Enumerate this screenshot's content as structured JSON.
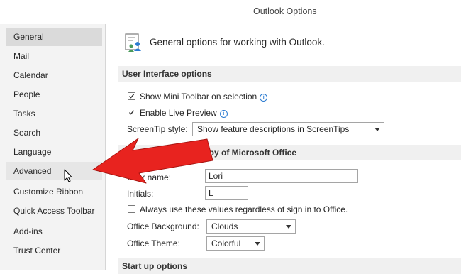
{
  "window": {
    "title": "Outlook Options"
  },
  "sidebar": {
    "items": [
      {
        "label": "General"
      },
      {
        "label": "Mail"
      },
      {
        "label": "Calendar"
      },
      {
        "label": "People"
      },
      {
        "label": "Tasks"
      },
      {
        "label": "Search"
      },
      {
        "label": "Language"
      },
      {
        "label": "Advanced"
      },
      {
        "label": "Customize Ribbon"
      },
      {
        "label": "Quick Access Toolbar"
      },
      {
        "label": "Add-ins"
      },
      {
        "label": "Trust Center"
      }
    ],
    "selected": "General",
    "hovered": "Advanced"
  },
  "main": {
    "header": "General options for working with Outlook.",
    "ui_options": {
      "title": "User Interface options",
      "mini_toolbar": {
        "label": "Show Mini Toolbar on selection",
        "checked": true
      },
      "live_preview": {
        "label": "Enable Live Preview",
        "checked": true
      },
      "screentip": {
        "label": "ScreenTip style:",
        "value": "Show feature descriptions in ScreenTips"
      }
    },
    "personalize": {
      "title": "Personalize your copy of Microsoft Office",
      "visible_title": "our copy of Microsoft Office",
      "user_name": {
        "label": "User name:",
        "value": "Lori"
      },
      "initials": {
        "label": "Initials:",
        "value": "L"
      },
      "always_use": {
        "label": "Always use these values regardless of sign in to Office.",
        "checked": false
      },
      "background": {
        "label": "Office Background:",
        "value": "Clouds"
      },
      "theme": {
        "label": "Office Theme:",
        "value": "Colorful"
      }
    },
    "startup": {
      "title": "Start up options"
    }
  },
  "colors": {
    "arrow": "#e8231f",
    "selected": "#dadada",
    "section": "#f0f0f0"
  },
  "icons": {
    "page": "general-options-icon",
    "info": "info-icon",
    "cursor": "mouse-cursor-icon",
    "arrow": "red-arrow-icon"
  }
}
